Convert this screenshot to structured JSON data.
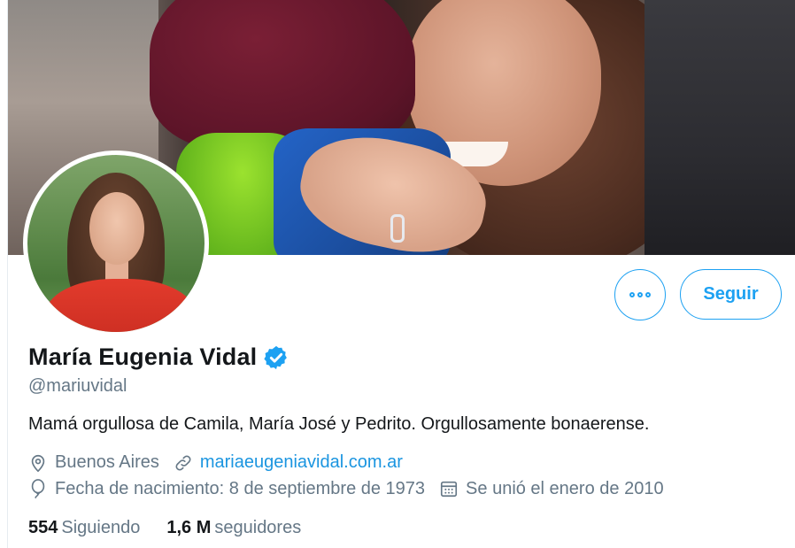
{
  "profile": {
    "name": "María Eugenia Vidal",
    "handle": "@mariuvidal",
    "bio": "Mamá orgullosa de Camila, María José y Pedrito. Orgullosamente bonaerense.",
    "verified": true
  },
  "actions": {
    "follow_label": "Seguir",
    "more_icon": "more-dots-icon"
  },
  "meta": {
    "location": "Buenos Aires",
    "website": "mariaeugeniavidal.com.ar",
    "birthday": "Fecha de nacimiento: 8 de septiembre de 1973",
    "joined": "Se unió el enero de 2010",
    "icons": [
      "location-pin-icon",
      "link-icon",
      "balloon-icon",
      "calendar-icon"
    ]
  },
  "stats": {
    "following_count": "554",
    "following_label": "Siguiendo",
    "followers_count": "1,6 M",
    "followers_label": "seguidores"
  },
  "colors": {
    "accent": "#1da1f2",
    "secondary_text": "#657786",
    "primary_text": "#14171a"
  }
}
